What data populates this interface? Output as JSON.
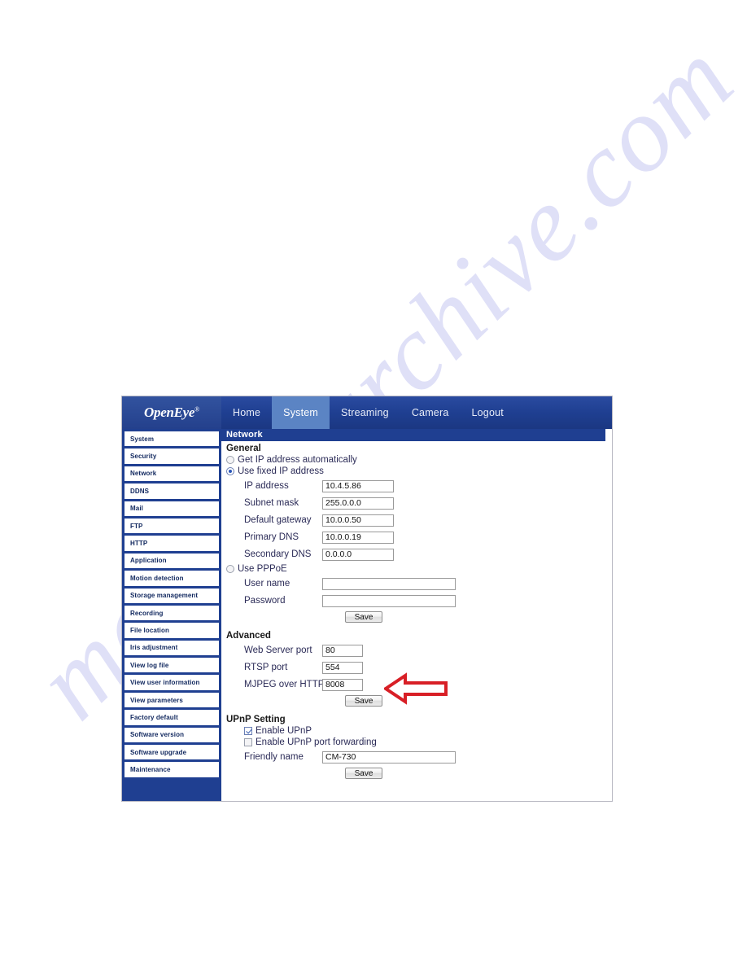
{
  "watermark": {
    "text": "manualsarchive.com"
  },
  "header": {
    "logo": "OpenEye",
    "logo_mark": "®",
    "nav": [
      {
        "label": "Home",
        "active": false
      },
      {
        "label": "System",
        "active": true
      },
      {
        "label": "Streaming",
        "active": false
      },
      {
        "label": "Camera",
        "active": false
      },
      {
        "label": "Logout",
        "active": false
      }
    ]
  },
  "sidebar": {
    "items": [
      {
        "label": "System"
      },
      {
        "label": "Security"
      },
      {
        "label": "Network"
      },
      {
        "label": "DDNS"
      },
      {
        "label": "Mail"
      },
      {
        "label": "FTP"
      },
      {
        "label": "HTTP"
      },
      {
        "label": "Application"
      },
      {
        "label": "Motion detection"
      },
      {
        "label": "Storage management"
      },
      {
        "label": "Recording"
      },
      {
        "label": "File location"
      },
      {
        "label": "Iris adjustment"
      },
      {
        "label": "View log file"
      },
      {
        "label": "View user information"
      },
      {
        "label": "View parameters"
      },
      {
        "label": "Factory default"
      },
      {
        "label": "Software version"
      },
      {
        "label": "Software upgrade"
      },
      {
        "label": "Maintenance"
      }
    ]
  },
  "page": {
    "title": "Network",
    "general": {
      "heading": "General",
      "radio_auto": "Get IP address automatically",
      "radio_fixed": "Use fixed IP address",
      "radio_pppoe": "Use PPPoE",
      "fields": [
        {
          "label": "IP address",
          "value": "10.4.5.86"
        },
        {
          "label": "Subnet mask",
          "value": "255.0.0.0"
        },
        {
          "label": "Default gateway",
          "value": "10.0.0.50"
        },
        {
          "label": "Primary DNS",
          "value": "10.0.0.19"
        },
        {
          "label": "Secondary DNS",
          "value": "0.0.0.0"
        }
      ],
      "pppoe_fields": [
        {
          "label": "User name",
          "value": ""
        },
        {
          "label": "Password",
          "value": ""
        }
      ],
      "save_label": "Save"
    },
    "advanced": {
      "heading": "Advanced",
      "fields": [
        {
          "label": "Web Server port",
          "value": "80"
        },
        {
          "label": "RTSP port",
          "value": "554"
        },
        {
          "label": "MJPEG over HTTP port",
          "value": "8008"
        }
      ],
      "save_label": "Save"
    },
    "upnp": {
      "heading": "UPnP Setting",
      "enable_upnp": "Enable UPnP",
      "enable_forwarding": "Enable UPnP port forwarding",
      "friendly_name_label": "Friendly name",
      "friendly_name_value": "CM-730",
      "save_label": "Save"
    }
  },
  "annotation": {
    "arrow_color": "#d81f26",
    "direction": "left"
  }
}
